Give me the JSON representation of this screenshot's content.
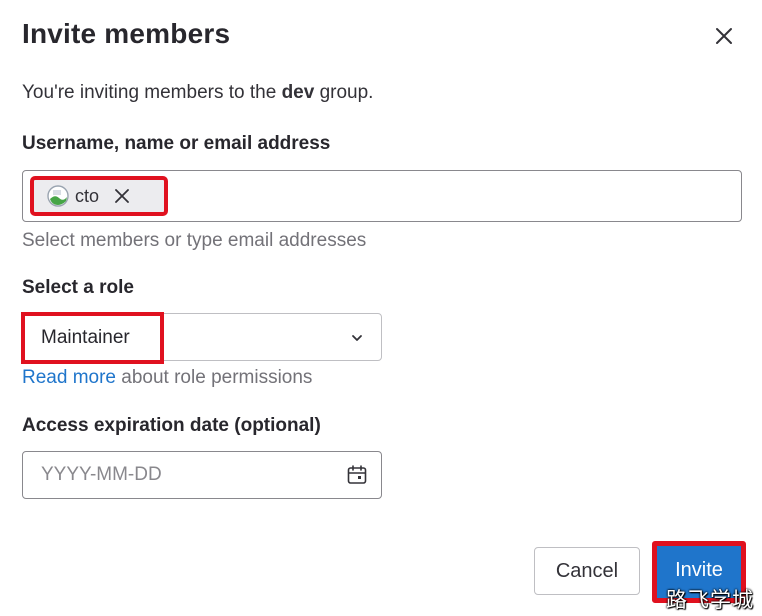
{
  "modal": {
    "title": "Invite members",
    "intro_prefix": "You're inviting members to the ",
    "group_name": "dev",
    "intro_suffix": " group."
  },
  "members": {
    "label": "Username, name or email address",
    "token_text": "cto",
    "help_text": "Select members or type email addresses"
  },
  "role": {
    "label": "Select a role",
    "selected": "Maintainer",
    "link_text": "Read more",
    "link_suffix": " about role permissions"
  },
  "expiration": {
    "label": "Access expiration date (optional)",
    "placeholder": "YYYY-MM-DD",
    "value": ""
  },
  "footer": {
    "cancel_label": "Cancel",
    "invite_label": "Invite"
  },
  "watermark": "路飞学城",
  "colors": {
    "primary": "#1f75cb",
    "highlight": "#e0111f",
    "text": "#333238",
    "muted": "#737278"
  }
}
